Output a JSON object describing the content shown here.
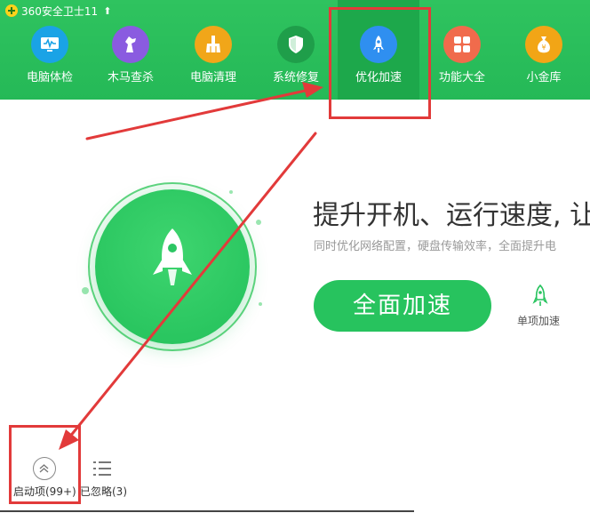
{
  "app": {
    "title": "360安全卫士11",
    "up_arrow": "⬆"
  },
  "nav": {
    "items": [
      {
        "label": "电脑体检",
        "icon": "monitor-icon",
        "color": "#1aa3e6"
      },
      {
        "label": "木马查杀",
        "icon": "horse-icon",
        "color": "#8a5be0"
      },
      {
        "label": "电脑清理",
        "icon": "broom-icon",
        "color": "#f1a619"
      },
      {
        "label": "系统修复",
        "icon": "shield-icon",
        "color": "#1f9e4a"
      },
      {
        "label": "优化加速",
        "icon": "rocket-icon",
        "color": "#2f8ff0",
        "active": true
      },
      {
        "label": "功能大全",
        "icon": "grid-icon",
        "color": "#f06b4c"
      },
      {
        "label": "小金库",
        "icon": "money-bag-icon",
        "color": "#f2a516"
      }
    ]
  },
  "main": {
    "headline": "提升开机、运行速度, 让",
    "subline": "同时优化网络配置，硬盘传输效率，全面提升电",
    "primary_button": "全面加速",
    "single_item_label": "单项加速"
  },
  "footer": {
    "startup_label": "启动项(99+)",
    "ignored_label": "已忽略(3)"
  },
  "colors": {
    "brand_green": "#27c35e",
    "annotation_red": "#e23a3a"
  }
}
